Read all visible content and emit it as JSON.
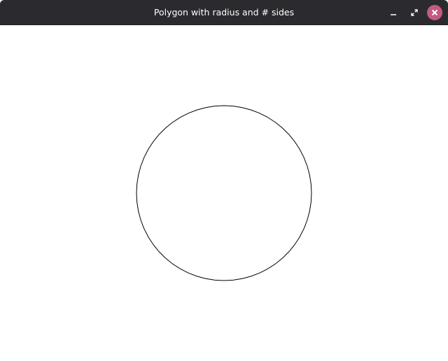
{
  "window": {
    "title": "Polygon with radius and # sides"
  },
  "titlebar_buttons": {
    "minimize_icon": "minimize-icon",
    "maximize_icon": "maximize-icon",
    "close_icon": "close-icon",
    "close_color": "#c25b7f"
  },
  "drawing": {
    "shape": "polygon",
    "stroke_color": "#000000",
    "fill_color": "#ffffff",
    "background_color": "#ffffff"
  }
}
